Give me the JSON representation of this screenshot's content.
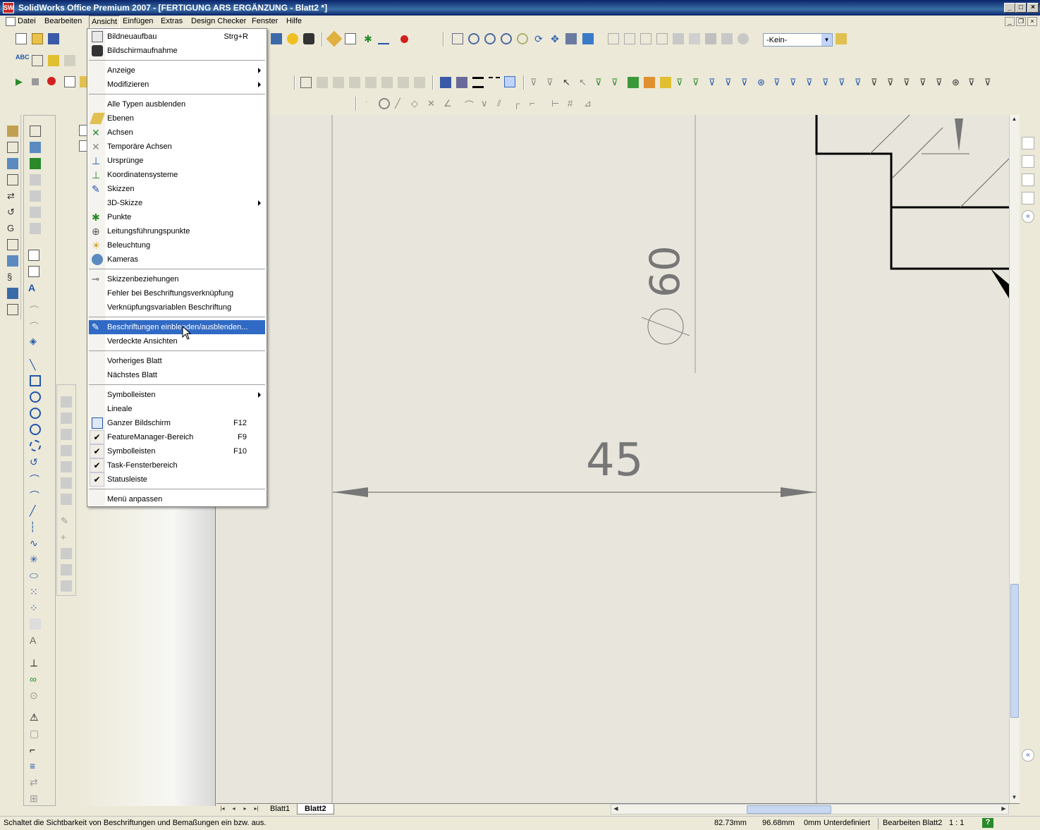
{
  "window": {
    "title": "SolidWorks Office Premium 2007 - [FERTIGUNG ARS ERGÄNZUNG - Blatt2 *]",
    "app_icon": "SW",
    "min_label": "_",
    "max_label": "□",
    "close_label": "×"
  },
  "menubar": {
    "items": [
      "Datei",
      "Bearbeiten",
      "Ansicht",
      "Einfügen",
      "Extras",
      "Design Checker",
      "Fenster",
      "Hilfe"
    ],
    "active": "Ansicht"
  },
  "toolbar": {
    "config_select": "-Kein-"
  },
  "view_menu": {
    "items": [
      {
        "label": "Bildneuaufbau",
        "shortcut": "Strg+R",
        "icon": "rebuild-icon"
      },
      {
        "label": "Bildschirmaufnahme",
        "icon": "camera-icon"
      },
      {
        "label": "Anzeige",
        "submenu": true
      },
      {
        "label": "Modifizieren",
        "submenu": true
      },
      {
        "label": "Alle Typen ausblenden"
      },
      {
        "label": "Ebenen",
        "icon": "planes-icon"
      },
      {
        "label": "Achsen",
        "icon": "axes-icon"
      },
      {
        "label": "Temporäre Achsen",
        "icon": "temp-axes-icon"
      },
      {
        "label": "Ursprünge",
        "icon": "origins-icon"
      },
      {
        "label": "Koordinatensysteme",
        "icon": "coordinate-systems-icon"
      },
      {
        "label": "Skizzen",
        "icon": "sketches-icon"
      },
      {
        "label": "3D-Skizze",
        "submenu": true
      },
      {
        "label": "Punkte",
        "icon": "points-icon"
      },
      {
        "label": "Leitungsführungspunkte",
        "icon": "routing-points-icon"
      },
      {
        "label": "Beleuchtung",
        "icon": "lighting-icon"
      },
      {
        "label": "Kameras",
        "icon": "cameras-icon"
      },
      {
        "label": "Skizzenbeziehungen",
        "icon": "sketch-relations-icon"
      },
      {
        "label": "Fehler bei Beschriftungsverknüpfung"
      },
      {
        "label": "Verknüpfungsvariablen Beschriftung"
      },
      {
        "label": "Beschriftungen einblenden/ausblenden...",
        "icon": "annotations-icon",
        "highlighted": true
      },
      {
        "label": "Verdeckte Ansichten"
      },
      {
        "label": "Vorheriges Blatt"
      },
      {
        "label": "Nächstes Blatt"
      },
      {
        "label": "Symbolleisten",
        "submenu": true
      },
      {
        "label": "Lineale"
      },
      {
        "label": "Ganzer Bildschirm",
        "shortcut": "F12",
        "icon": "fullscreen-icon"
      },
      {
        "label": "FeatureManager-Bereich",
        "shortcut": "F9",
        "checked": true
      },
      {
        "label": "Symbolleisten",
        "shortcut": "F10",
        "checked": true
      },
      {
        "label": "Task-Fensterbereich",
        "checked": true
      },
      {
        "label": "Statusleiste",
        "checked": true
      },
      {
        "label": "Menü anpassen"
      }
    ]
  },
  "drawing": {
    "dim_diameter": "60",
    "dim_diameter_symbol": "⌀",
    "dim_length": "45"
  },
  "sheet_tabs": {
    "tabs": [
      "Blatt1",
      "Blatt2"
    ],
    "active": "Blatt2"
  },
  "status": {
    "message": "Schaltet die Sichtbarkeit von Beschriftungen und Bemaßungen ein bzw. aus.",
    "x": "82.73mm",
    "y": "96.68mm",
    "z": "0mm",
    "state": "Unterdefiniert",
    "mode": "Bearbeiten Blatt2",
    "scale": "1 : 1",
    "help": "?"
  },
  "colors": {
    "title_bar": "#0a246a",
    "menu_highlight": "#316ac5",
    "sheet_bg": "#e8e6dc",
    "dimension": "#777777"
  }
}
